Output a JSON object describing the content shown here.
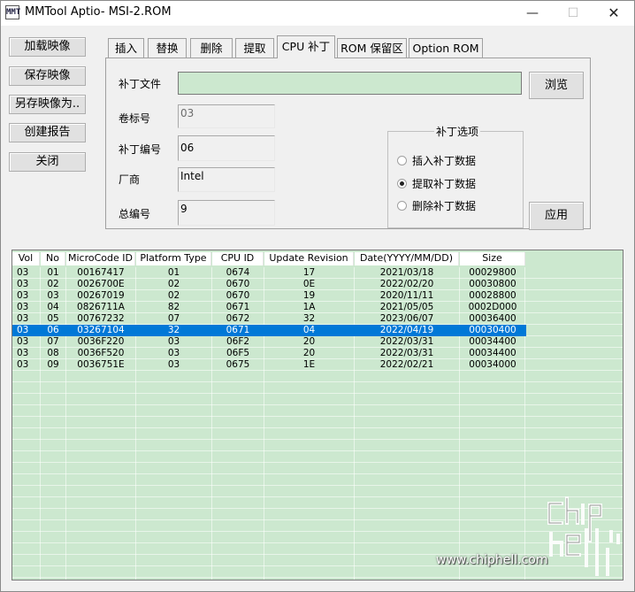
{
  "window": {
    "title": "MMTool Aptio- MSI-2.ROM",
    "icon_label": "MMT",
    "controls": [
      "—",
      "☐",
      "✕"
    ]
  },
  "left_buttons": [
    "加载映像",
    "保存映像",
    "另存映像为..",
    "创建报告",
    "关闭"
  ],
  "tabs": [
    "插入",
    "替换",
    "删除",
    "提取",
    "CPU 补丁",
    "ROM 保留区",
    "Option ROM"
  ],
  "active_tab": "CPU 补丁",
  "panel": {
    "patch_file_label": "补丁文件",
    "patch_file_value": "",
    "browse_button": "浏览",
    "volume_label": "卷标号",
    "volume_value": "03",
    "patch_no_label": "补丁编号",
    "patch_no_value": "06",
    "vendor_label": "厂商",
    "vendor_value": "Intel",
    "total_label": "总编号",
    "total_value": "9",
    "options_title": "补丁选项",
    "options": [
      {
        "label": "插入补丁数据",
        "checked": false
      },
      {
        "label": "提取补丁数据",
        "checked": true
      },
      {
        "label": "删除补丁数据",
        "checked": false
      }
    ],
    "apply_button": "应用"
  },
  "table": {
    "columns": [
      "Vol",
      "No",
      "MicroCode ID",
      "Platform Type",
      "CPU ID",
      "Update Revision",
      "Date(YYYY/MM/DD)",
      "Size"
    ],
    "rows": [
      [
        "03",
        "01",
        "00167417",
        "01",
        "0674",
        "17",
        "2021/03/18",
        "00029800"
      ],
      [
        "03",
        "02",
        "0026700E",
        "02",
        "0670",
        "0E",
        "2022/02/20",
        "00030800"
      ],
      [
        "03",
        "03",
        "00267019",
        "02",
        "0670",
        "19",
        "2020/11/11",
        "00028800"
      ],
      [
        "03",
        "04",
        "0826711A",
        "82",
        "0671",
        "1A",
        "2021/05/05",
        "0002D000"
      ],
      [
        "03",
        "05",
        "00767232",
        "07",
        "0672",
        "32",
        "2023/06/07",
        "00036400"
      ],
      [
        "03",
        "06",
        "03267104",
        "32",
        "0671",
        "04",
        "2022/04/19",
        "00030400"
      ],
      [
        "03",
        "07",
        "0036F220",
        "03",
        "06F2",
        "20",
        "2022/03/31",
        "00034400"
      ],
      [
        "03",
        "08",
        "0036F520",
        "03",
        "06F5",
        "20",
        "2022/03/31",
        "00034400"
      ],
      [
        "03",
        "09",
        "0036751E",
        "03",
        "0675",
        "1E",
        "2022/02/21",
        "00034000"
      ]
    ],
    "selected_row": 5
  },
  "watermark": {
    "logo_text": "chiphell",
    "url": "www.chiphell.com"
  },
  "colors": {
    "table_bg": "#cce8cf",
    "selection": "#0078d7",
    "window_bg": "#f0f0f0"
  }
}
